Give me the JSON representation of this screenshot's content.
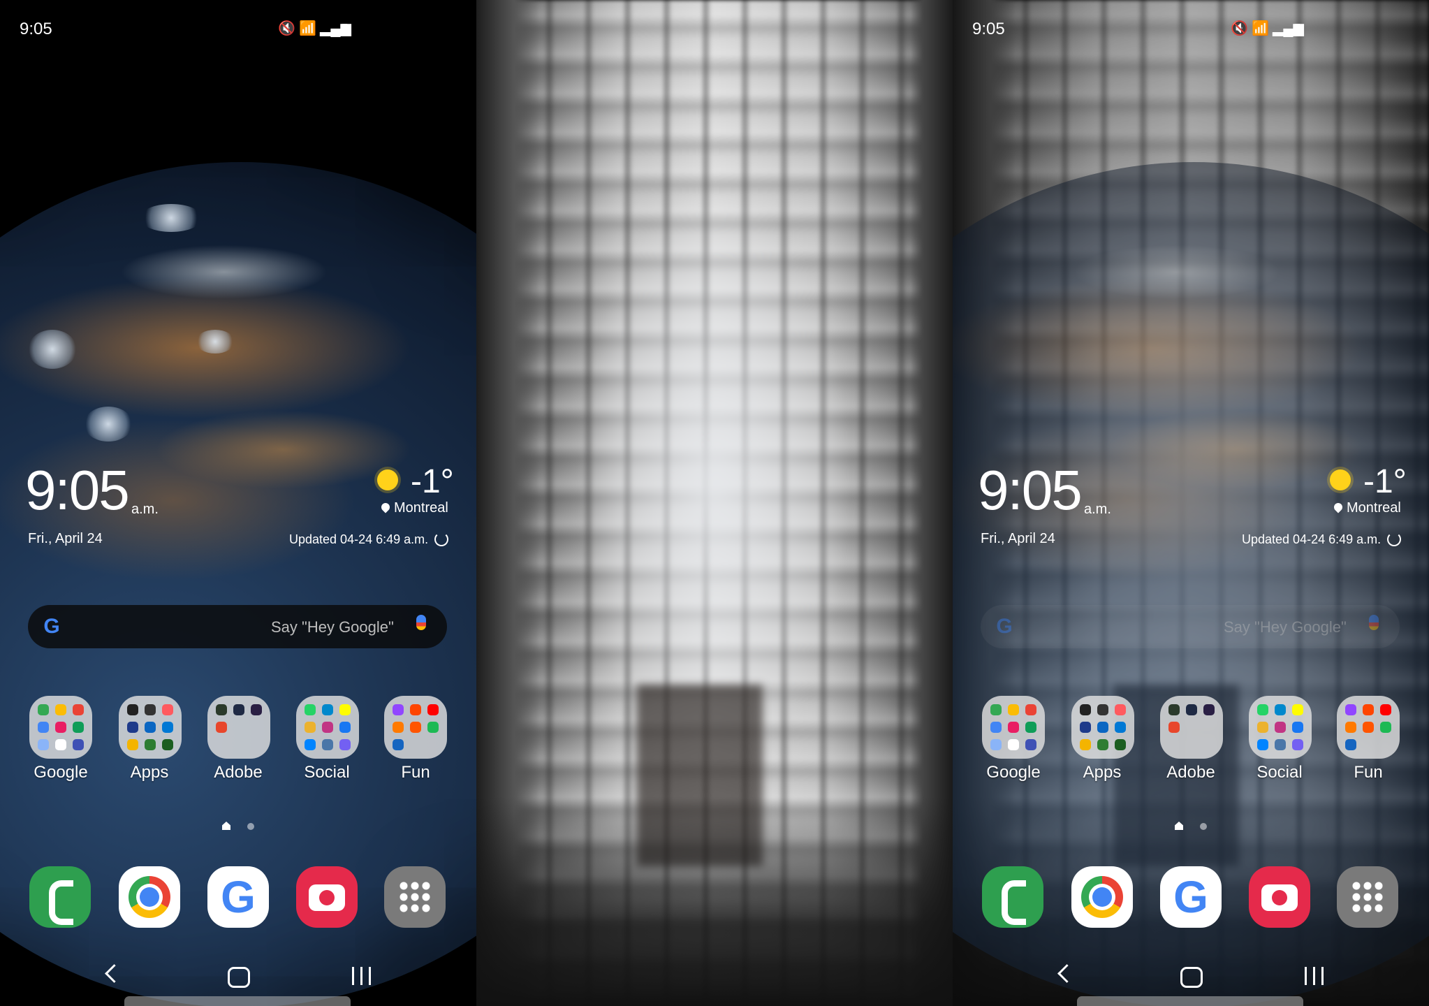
{
  "status_bar": {
    "time": "9:05"
  },
  "clock_widget": {
    "time": "9:05",
    "ampm": "a.m.",
    "date": "Fri., April 24",
    "temperature": "-1°",
    "location": "Montreal",
    "updated": "Updated 04-24 6:49 a.m."
  },
  "search_bar": {
    "hint": "Say \"Hey Google\"",
    "logo": "G"
  },
  "folders": [
    {
      "label": "Google"
    },
    {
      "label": "Apps"
    },
    {
      "label": "Adobe"
    },
    {
      "label": "Social"
    },
    {
      "label": "Fun"
    }
  ],
  "dock": {
    "apps": [
      {
        "name": "phone-icon"
      },
      {
        "name": "chrome-icon"
      },
      {
        "name": "google-icon",
        "glyph": "G"
      },
      {
        "name": "camera-icon"
      },
      {
        "name": "app-drawer-icon"
      }
    ]
  },
  "colors": {
    "sun": "#ffd21a",
    "phone": "#2e9f4f",
    "camera": "#e52a4b",
    "drawer": "#7a7a7a"
  },
  "panels": [
    "home-screen-wallpaper",
    "camera-view",
    "transparent-overlay-home-screen"
  ]
}
